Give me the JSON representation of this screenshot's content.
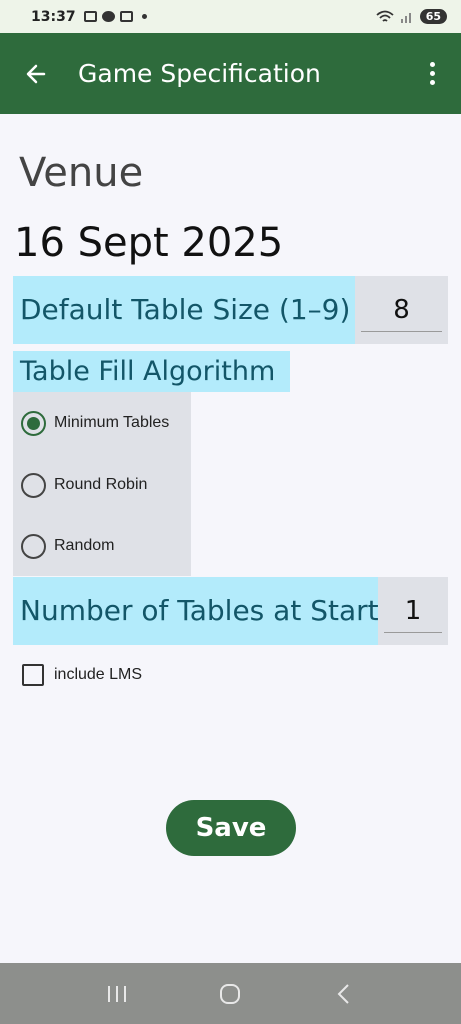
{
  "status_bar": {
    "time": "13:37",
    "battery": "65"
  },
  "app_bar": {
    "title": "Game Specification"
  },
  "venue": "Venue",
  "date": "16 Sept 2025",
  "table_size": {
    "label": "Default Table Size (1–9)",
    "value": "8"
  },
  "fill_algorithm": {
    "label": "Table Fill Algorithm",
    "options": [
      {
        "label": "Minimum Tables",
        "selected": true
      },
      {
        "label": "Round Robin",
        "selected": false
      },
      {
        "label": "Random",
        "selected": false
      }
    ]
  },
  "tables_at_start": {
    "label": "Number of Tables at Start",
    "value": "1"
  },
  "include_lms": {
    "label": "include LMS",
    "checked": false
  },
  "save_label": "Save",
  "colors": {
    "primary": "#2e6b3c",
    "highlight": "#b3ebfb",
    "highlight_text": "#135668",
    "field_bg": "#dfe1e7"
  }
}
